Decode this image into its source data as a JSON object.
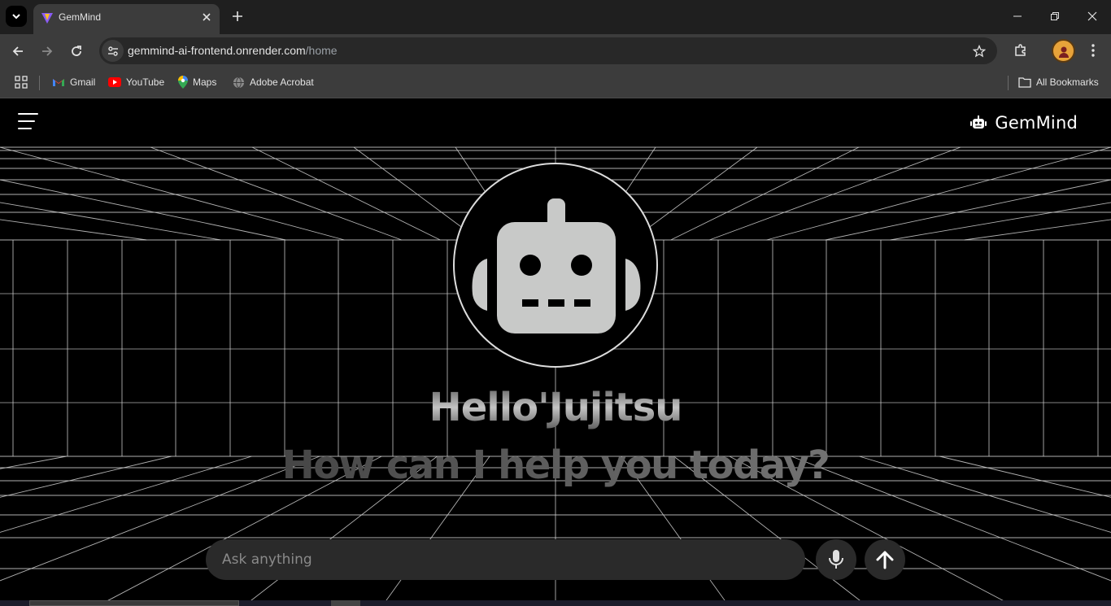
{
  "browser": {
    "tab": {
      "title": "GemMind"
    },
    "url": {
      "host": "gemmind-ai-frontend.onrender.com",
      "path": "/home"
    },
    "bookmarks": [
      {
        "label": "Gmail",
        "icon": "gmail-icon"
      },
      {
        "label": "YouTube",
        "icon": "youtube-icon"
      },
      {
        "label": "Maps",
        "icon": "maps-icon"
      },
      {
        "label": "Adobe Acrobat",
        "icon": "globe-icon"
      }
    ],
    "all_bookmarks_label": "All Bookmarks"
  },
  "app": {
    "brand": "GemMind",
    "greeting": "Hello'Jujitsu",
    "subtitle": "How can I help you today?",
    "input": {
      "placeholder": "Ask anything",
      "value": ""
    },
    "colors": {
      "background": "#000000",
      "grid": "#d0d0d0",
      "robot": "#c8c9c8",
      "input_bg": "#2a2a2a"
    }
  }
}
